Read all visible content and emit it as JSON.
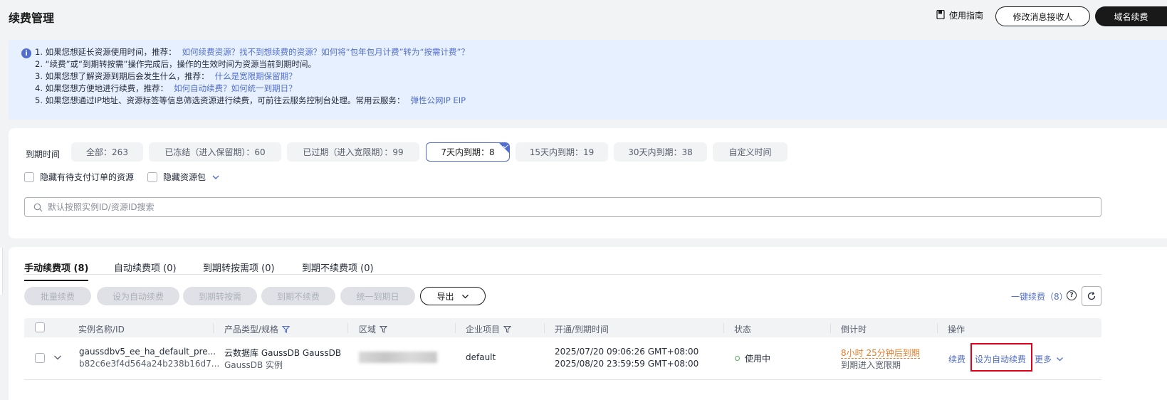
{
  "header": {
    "title": "续费管理",
    "guide_label": "使用指南",
    "modify_receiver_label": "修改消息接收人",
    "domain_renew_label": "域名续费"
  },
  "notice": {
    "lines": [
      {
        "text": "1. 如果您想延长资源使用时间，推荐：",
        "link": "如何续费资源？找不到想续费的资源？如何将“包年包月计费”转为“按需计费”？"
      },
      {
        "text": "2. “续费”或“到期转按需”操作完成后，操作的生效时间为资源当前到期时间。",
        "link": ""
      },
      {
        "text": "3. 如果您想了解资源到期后会发生什么，推荐：",
        "link": "什么是宽限期保留期？"
      },
      {
        "text": "4. 如果您想方便地进行续费，推荐：",
        "link": "如何自动续费？如何统一到期日？"
      },
      {
        "text": "5. 如果您想通过IP地址、资源标签等信息筛选资源进行续费，可前往云服务控制台处理。常用云服务：",
        "link": "弹性公网IP EIP"
      }
    ]
  },
  "filters": {
    "label": "到期时间",
    "chips": [
      "全部：263",
      "已冻结（进入保留期）：60",
      "已过期（进入宽限期）：99",
      "7天内到期：8",
      "15天内到期：19",
      "30天内到期：38",
      "自定义时间"
    ],
    "active_chip": "7天内到期：8",
    "hide_pending_orders": "隐藏有待支付订单的资源",
    "hide_packages": "隐藏资源包",
    "search_placeholder": "默认按照实例ID/资源ID搜索"
  },
  "tabs": [
    "手动续费项 (8)",
    "自动续费项 (0)",
    "到期转按需项 (0)",
    "到期不续费项 (0)"
  ],
  "active_tab": "手动续费项 (8)",
  "actions": {
    "batch_renew": "批量续费",
    "set_auto_renew": "设为自动续费",
    "to_on_demand": "到期转按需",
    "no_renew": "到期不续费",
    "unify_expiry": "统一到期日",
    "export": "导出",
    "one_click_renew": "一键续费（8）"
  },
  "table": {
    "columns": [
      "实例名称/ID",
      "产品类型/规格",
      "区域",
      "企业项目",
      "开通/到期时间",
      "状态",
      "倒计时",
      "操作"
    ],
    "rows": [
      {
        "name": "gaussdbv5_ee_ha_default_pre...",
        "id": "b82c6e3f4d564a24b238b16d7...",
        "product": "云数据库 GaussDB GaussDB",
        "spec": "GaussDB 实例",
        "region": "",
        "enterprise_project": "default",
        "open_time": "2025/07/20 09:06:26 GMT+08:00",
        "expire_time": "2025/08/20 23:59:59 GMT+08:00",
        "status": "使用中",
        "countdown": "8小时 25分钟后到期",
        "countdown_note": "到期进入宽限期",
        "op_renew": "续费",
        "op_auto_renew": "设为自动续费",
        "op_more": "更多"
      }
    ]
  },
  "colors": {
    "link": "#526ecc",
    "warning": "#e37d29",
    "highlight": "#e0001b",
    "status_ok": "#5aa860"
  }
}
